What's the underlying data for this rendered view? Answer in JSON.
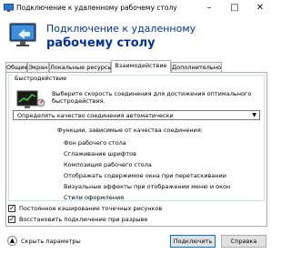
{
  "window": {
    "title": "Подключение к удаленному рабочему столу",
    "minimize_glyph": "–",
    "maximize_glyph": "□",
    "close_glyph": "✕"
  },
  "header": {
    "line1": "Подключение к удаленному",
    "line2": "рабочему столу"
  },
  "tabs": [
    {
      "label": "Общие"
    },
    {
      "label": "Экран"
    },
    {
      "label": "Локальные ресурсы"
    },
    {
      "label": "Взаимодействие",
      "active": true
    },
    {
      "label": "Дополнительно"
    }
  ],
  "performance": {
    "group_label": "Быстродействие",
    "description": "Выберите скорость соединения для достижения оптимального быстродействия.",
    "selected": "Определять качество соединения автоматически",
    "features_title": "Функции, зависимые от качества соединения:",
    "features": [
      "Фон рабочего стола",
      "Сглаживание шрифтов",
      "Композиция рабочего стола",
      "Отображать содержимое окна при перетаскивании",
      "Визуальные эффекты при отображении меню и окон",
      "Стили оформления"
    ]
  },
  "checkboxes": [
    {
      "label": "Постоянное кэширование точечных рисунков",
      "checked": true
    },
    {
      "label": "Восстановить подключение при разрыве",
      "checked": true
    }
  ],
  "footer": {
    "hide_label": "Скрыть параметры",
    "hide_glyph": "▲",
    "connect_label": "Подключить",
    "help_label": "Справка"
  },
  "colors": {
    "header_text": "#003399",
    "default_button_border": "#0078d7"
  }
}
